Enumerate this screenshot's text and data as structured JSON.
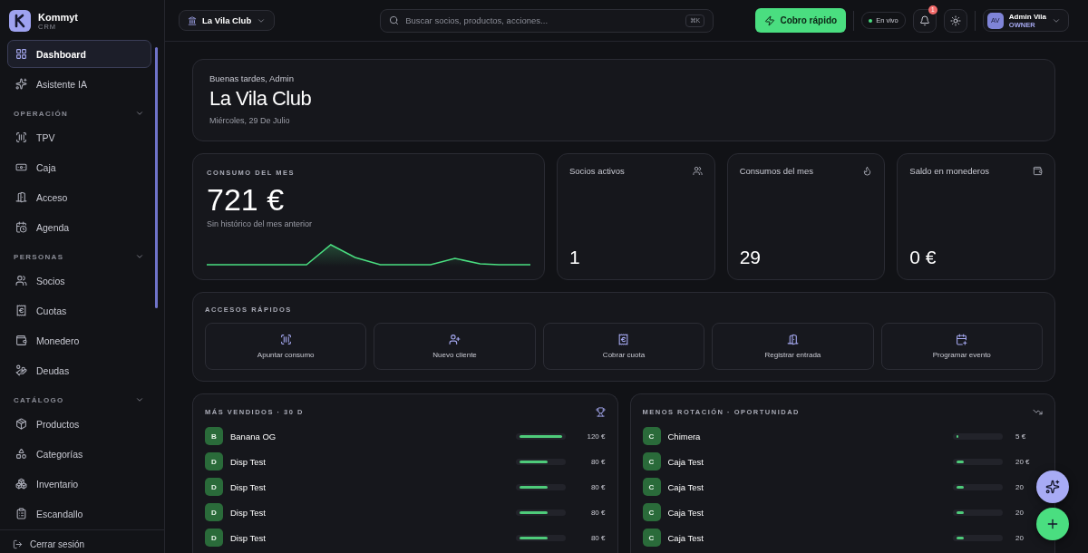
{
  "app": {
    "name": "Kommyt",
    "subtitle": "CRM"
  },
  "sidebar": {
    "items": [
      {
        "label": "Dashboard",
        "selected": true
      },
      {
        "label": "Asistente IA",
        "selected": false
      }
    ],
    "sections": [
      {
        "title": "OPERACIÓN",
        "expanded": true,
        "children": [
          {
            "label": "TPV",
            "selected": false
          },
          {
            "label": "Caja",
            "selected": false
          },
          {
            "label": "Acceso",
            "selected": false
          },
          {
            "label": "Agenda",
            "selected": false
          }
        ]
      },
      {
        "title": "PERSONAS",
        "expanded": true,
        "children": [
          {
            "label": "Socios",
            "selected": false
          },
          {
            "label": "Cuotas",
            "selected": false
          },
          {
            "label": "Monedero",
            "selected": false
          },
          {
            "label": "Deudas",
            "selected": false
          }
        ]
      },
      {
        "title": "CATÁLOGO",
        "expanded": true,
        "children": [
          {
            "label": "Productos",
            "selected": false
          },
          {
            "label": "Categorías",
            "selected": false
          },
          {
            "label": "Inventario",
            "selected": false
          },
          {
            "label": "Escandallo",
            "selected": false
          }
        ]
      }
    ],
    "logout": "Cerrar sesión"
  },
  "header": {
    "club": "La Vila Club",
    "search": {
      "placeholder": "Buscar socios, productos, acciones...",
      "shortcut": "⌘K"
    },
    "quick_pay": "Cobro rápido",
    "live": "En vivo",
    "notifications": "1",
    "user": {
      "initials": "AV",
      "name": "Admin Vila",
      "role": "OWNER"
    }
  },
  "hero": {
    "greeting": "Buenas tardes, Admin",
    "title": "La Vila Club",
    "date": "Miércoles, 29 De Julio"
  },
  "consumo": {
    "label": "CONSUMO DEL MES",
    "value": "721 €",
    "note": "Sin histórico del mes anterior"
  },
  "stats": [
    {
      "label": "Socios activos",
      "value": "1"
    },
    {
      "label": "Consumos del mes",
      "value": "29"
    },
    {
      "label": "Saldo en monederos",
      "value": "0 €"
    }
  ],
  "quick_access": {
    "title": "ACCESOS RÁPIDOS",
    "items": [
      "Apuntar consumo",
      "Nuevo cliente",
      "Cobrar cuota",
      "Registrar entrada",
      "Programar evento"
    ]
  },
  "top_sellers": {
    "title": "MÁS VENDIDOS · 30 D",
    "rows": [
      {
        "initial": "B",
        "name": "Banana OG",
        "level": 1,
        "amount": "120 €"
      },
      {
        "initial": "D",
        "name": "Disp Test",
        "level": 0.67,
        "amount": "80 €"
      },
      {
        "initial": "D",
        "name": "Disp Test",
        "level": 0.67,
        "amount": "80 €"
      },
      {
        "initial": "D",
        "name": "Disp Test",
        "level": 0.67,
        "amount": "80 €"
      },
      {
        "initial": "D",
        "name": "Disp Test",
        "level": 0.67,
        "amount": "80 €"
      }
    ]
  },
  "low_rotation": {
    "title": "MENOS ROTACIÓN · OPORTUNIDAD",
    "rows": [
      {
        "initial": "C",
        "name": "Chimera",
        "level": 0.05,
        "amount": "5 €"
      },
      {
        "initial": "C",
        "name": "Caja Test",
        "level": 0.17,
        "amount": "20 €"
      },
      {
        "initial": "C",
        "name": "Caja Test",
        "level": 0.17,
        "amount": "20"
      },
      {
        "initial": "C",
        "name": "Caja Test",
        "level": 0.17,
        "amount": "20"
      },
      {
        "initial": "C",
        "name": "Caja Test",
        "level": 0.17,
        "amount": "20"
      }
    ]
  }
}
